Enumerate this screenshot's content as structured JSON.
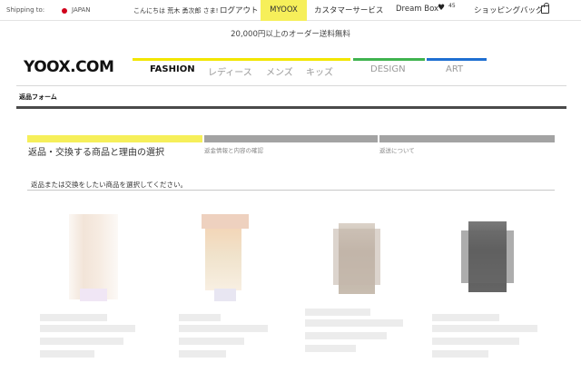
{
  "topbar": {
    "shipping_to_label": "Shipping to:",
    "country": "JAPAN",
    "greeting": "こんにちは 荒木 勇次郎 さま!",
    "logout": "ログアウト",
    "myoox": "MYOOX",
    "customer_service": "カスタマーサービス",
    "dream_box": "Dream Box",
    "dream_box_count": "45",
    "shopping_bag": "ショッピングバッグ"
  },
  "promo": "20,000円以上のオーダー送料無料",
  "brand": {
    "logo": "YOOX.COM"
  },
  "nav": {
    "fashion": "FASHION",
    "ladies": "レディース",
    "mens": "メンズ",
    "kids": "キッズ",
    "design": "DESIGN",
    "art": "ART"
  },
  "colors": {
    "yellow": "#f2e600",
    "green": "#3fb34f",
    "blue": "#1f6fd1",
    "step_active": "#f6ef5a",
    "step_inactive": "#a3a3a3"
  },
  "page": {
    "form_title": "返品フォーム",
    "steps": [
      {
        "label": "返品・交換する商品と理由の選択",
        "active": true
      },
      {
        "label": "返金情報と内容の確認",
        "active": false
      },
      {
        "label": "返送について",
        "active": false
      }
    ],
    "instruction": "返品または交換をしたい商品を選択してください。"
  }
}
